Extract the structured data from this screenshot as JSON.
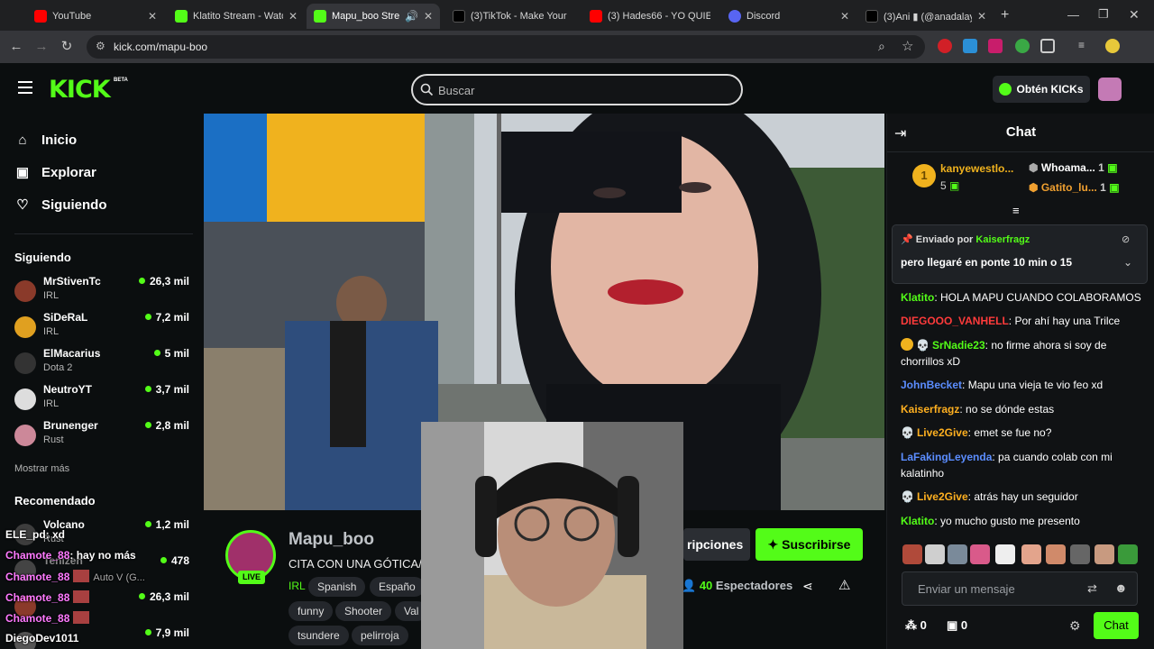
{
  "browser": {
    "tabs": [
      {
        "title": "YouTube",
        "icon": "youtube-icon",
        "color": "#ff0000"
      },
      {
        "title": "Klatito Stream - Watch",
        "icon": "kick-icon",
        "color": "#53fc18"
      },
      {
        "title": "Mapu_boo Stream",
        "icon": "kick-icon",
        "color": "#53fc18",
        "active": true
      },
      {
        "title": "(3)TikTok - Make Your",
        "icon": "tiktok-icon",
        "color": "#000000"
      },
      {
        "title": "(3) Hades66 - YO QUIE",
        "icon": "youtube-icon",
        "color": "#ff0000"
      },
      {
        "title": "Discord",
        "icon": "discord-icon",
        "color": "#5865f2"
      },
      {
        "title": "(3)Ani ▮ (@anadalay",
        "icon": "tiktok-icon",
        "color": "#000000"
      }
    ],
    "url": "kick.com/mapu-boo"
  },
  "header": {
    "logo": "KICK",
    "beta": "BETA",
    "search_placeholder": "Buscar",
    "get_kicks": "Obtén KICKs",
    "brand_color": "#53fc18"
  },
  "sidebar": {
    "nav": [
      {
        "label": "Inicio",
        "icon": "home-icon"
      },
      {
        "label": "Explorar",
        "icon": "explore-icon"
      },
      {
        "label": "Siguiendo",
        "icon": "heart-icon"
      }
    ],
    "following_title": "Siguiendo",
    "following": [
      {
        "name": "MrStivenTc",
        "game": "IRL",
        "viewers": "26,3 mil",
        "color": "#8a3a2a"
      },
      {
        "name": "SiDeRaL",
        "game": "IRL",
        "viewers": "7,2 mil",
        "color": "#e0a020"
      },
      {
        "name": "ElMacarius",
        "game": "Dota 2",
        "viewers": "5 mil",
        "color": "#333333"
      },
      {
        "name": "NeutroYT",
        "game": "IRL",
        "viewers": "3,7 mil",
        "color": "#dddddd"
      },
      {
        "name": "Brunenger",
        "game": "Rust",
        "viewers": "2,8 mil",
        "color": "#cc8899"
      }
    ],
    "show_more": "Mostrar más",
    "recommended_title": "Recomendado",
    "recommended": [
      {
        "name": "Volcano",
        "game": "Rust",
        "viewers": "1,2 mil"
      },
      {
        "name": "Tenizen",
        "game": "",
        "viewers": "478"
      },
      {
        "name": "",
        "game": "",
        "viewers": "26,3 mil"
      },
      {
        "name": "",
        "game": "",
        "viewers": "7,9 mil"
      }
    ]
  },
  "stream": {
    "channel": "Mapu_boo",
    "title": "CITA CON UNA GÓTICA/",
    "live": "LIVE",
    "category": "IRL",
    "tags_row1": [
      "Spanish",
      "Españo"
    ],
    "tags_row2": [
      "funny",
      "Shooter",
      "Val"
    ],
    "tags_row3": [
      "tsundere",
      "pelirroja"
    ],
    "subscriptions_btn": "ripciones",
    "subscribe_btn": "Suscribirse",
    "viewers": "40",
    "viewers_label": "Espectadores"
  },
  "overlay_chat": [
    {
      "user": "ELE_pd",
      "text": ": xd",
      "color": "#ffffff"
    },
    {
      "user": "Chamote_88",
      "text": ": hay no más",
      "color": "#ff7aff"
    },
    {
      "user": "Chamote_88",
      "text": "",
      "color": "#ff7aff"
    },
    {
      "user": "Chamote_88",
      "text": "",
      "color": "#ff7aff"
    },
    {
      "user": "Chamote_88",
      "text": "",
      "color": "#ff7aff"
    },
    {
      "user": "DiegoDev1011",
      "text": "",
      "color": "#ffffff"
    }
  ],
  "overlay_extra": {
    "auto_label": "Auto V (G..."
  },
  "chat": {
    "title": "Chat",
    "gifters": {
      "top": {
        "rank": "1",
        "name": "kanyewestlo...",
        "count": "5"
      },
      "second": {
        "name": "Whoama...",
        "count": "1"
      },
      "third": {
        "name": "Gatito_lu...",
        "count": "1"
      }
    },
    "pinned_label_prefix": "Enviado por",
    "pinned_by": "Kaiserfragz",
    "pinned_text": "pero llegaré en ponte 10 min o 15",
    "messages": [
      {
        "user": "Klatito",
        "text": ": HOLA MAPU CUANDO COLABORAMOS",
        "color": "#53fc18"
      },
      {
        "user": "DIEGOOO_VANHELL",
        "text": ": Por ahí hay una Trilce",
        "color": "#ff3b3b"
      },
      {
        "user": "SrNadie23",
        "text": ": no firme ahora si soy de chorrillos xD",
        "color": "#53fc18"
      },
      {
        "user": "JohnBecket",
        "text": ": Mapu una vieja te vio feo xd",
        "color": "#5b8dff"
      },
      {
        "user": "Kaiserfragz",
        "text": ": no se dónde estas",
        "color": "#ffb020"
      },
      {
        "user": "Live2Give",
        "text": ": emet se fue no?",
        "color": "#ffb020"
      },
      {
        "user": "LaFakingLeyenda",
        "text": ": pa cuando colab con mi kalatinho",
        "color": "#5b8dff"
      },
      {
        "user": "Live2Give",
        "text": ": atrás hay un seguidor",
        "color": "#ffb020"
      },
      {
        "user": "Klatito",
        "text": ": yo mucho gusto me presento",
        "color": "#53fc18"
      }
    ],
    "input_placeholder": "Enviar un mensaje",
    "points": "0",
    "kicks": "0",
    "send_button": "Chat"
  }
}
